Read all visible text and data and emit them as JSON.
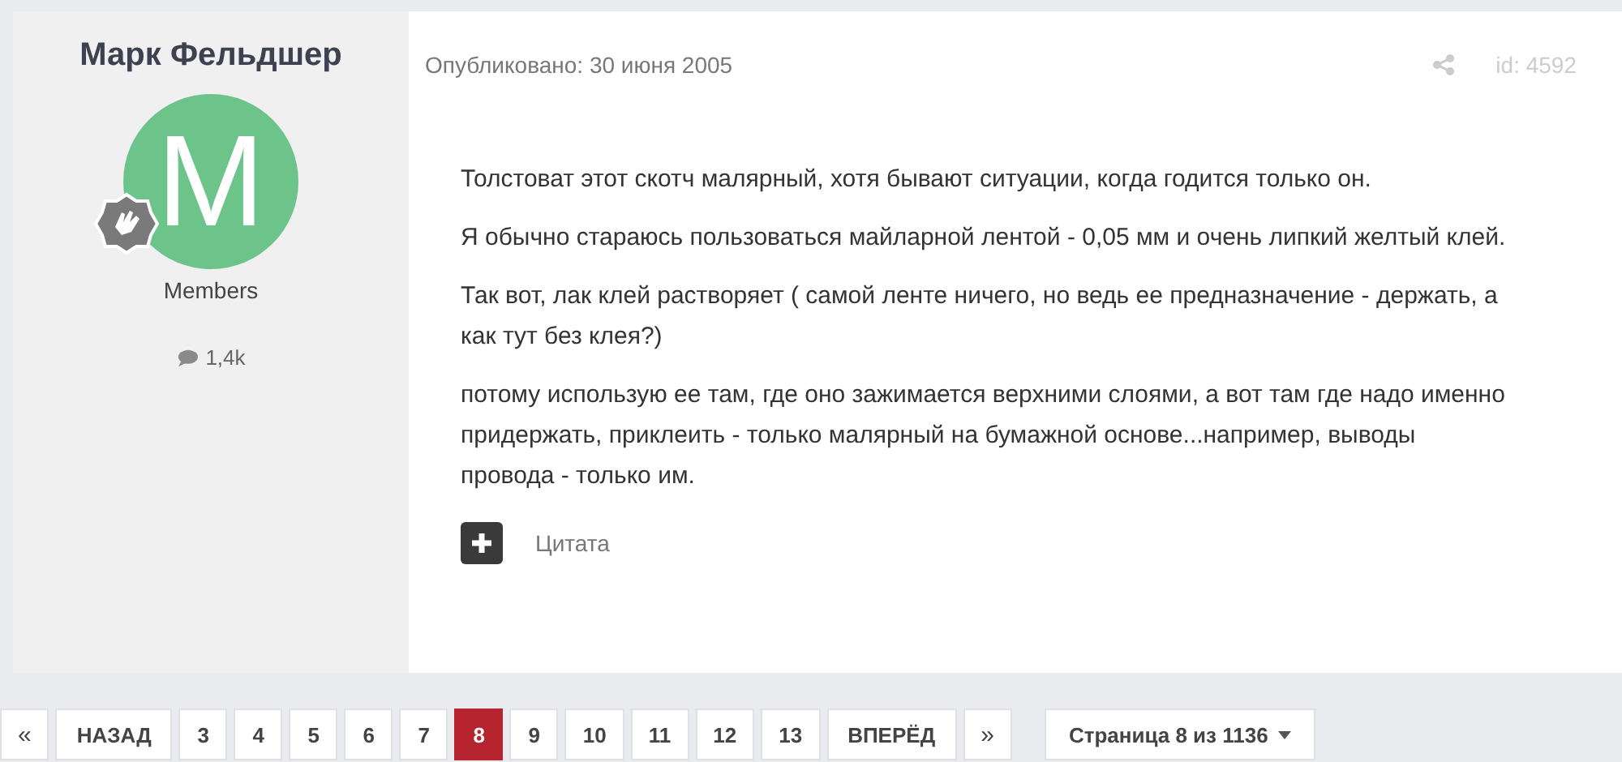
{
  "author": {
    "name": "Марк Фельдшер",
    "avatar_letter": "M",
    "group": "Members",
    "posts": "1,4k"
  },
  "post": {
    "published": "Опубликовано: 30 июня 2005",
    "id": "id: 4592",
    "paragraphs": [
      "Толстоват этот скотч малярный, хотя бывают ситуации, когда годится только он.",
      "Я обычно стараюсь пользоваться майларной лентой - 0,05 мм и очень липкий желтый клей.",
      "Так вот, лак клей растворяет ( самой ленте ничего, но ведь ее предназначение - держать, а как тут без клея?)",
      "потому использую ее там, где оно зажимается верхними слоями, а вот там где надо именно придержать, приклеить - только малярный на бумажной основе...например, выводы провода - только им."
    ],
    "quote_label": "Цитата"
  },
  "pagination": [
    {
      "kind": "first",
      "label": "«"
    },
    {
      "kind": "prev",
      "label": "НАЗАД"
    },
    {
      "kind": "page",
      "label": "3",
      "selected": false
    },
    {
      "kind": "page",
      "label": "4",
      "selected": false
    },
    {
      "kind": "page",
      "label": "5",
      "selected": false
    },
    {
      "kind": "page",
      "label": "6",
      "selected": false
    },
    {
      "kind": "page",
      "label": "7",
      "selected": false
    },
    {
      "kind": "page",
      "label": "8",
      "selected": true
    },
    {
      "kind": "page",
      "label": "9",
      "selected": false
    },
    {
      "kind": "page",
      "label": "10",
      "selected": false
    },
    {
      "kind": "page",
      "label": "11",
      "selected": false
    },
    {
      "kind": "page",
      "label": "12",
      "selected": false
    },
    {
      "kind": "page",
      "label": "13",
      "selected": false
    },
    {
      "kind": "next",
      "label": "ВПЕРЁД"
    },
    {
      "kind": "last",
      "label": "»"
    },
    {
      "kind": "jump",
      "label": "Страница 8 из 1136"
    }
  ]
}
